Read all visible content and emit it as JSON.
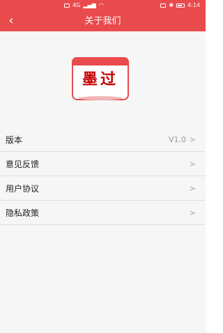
{
  "status_bar": {
    "signal": "4G",
    "time": "4:14"
  },
  "header": {
    "back_icon": "‹",
    "title": "关于我们",
    "bg_color": "#e94a4c"
  },
  "logo": {
    "text": "墨过"
  },
  "menu": {
    "items": [
      {
        "label": "版本",
        "value": "V1.0",
        "icon": "chevron-right-icon"
      },
      {
        "label": "意见反馈",
        "value": "",
        "icon": "chevron-right-icon"
      },
      {
        "label": "用户协议",
        "value": "",
        "icon": "chevron-right-icon"
      },
      {
        "label": "隐私政策",
        "value": "",
        "icon": "chevron-right-icon"
      }
    ],
    "chevron": ">"
  }
}
